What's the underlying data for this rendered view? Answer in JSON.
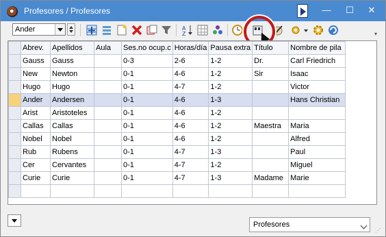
{
  "window": {
    "title": "Profesores / Profesores",
    "minimize": "—",
    "maximize": "☐",
    "close": "✕"
  },
  "toolbar": {
    "selector_value": "Ander",
    "icons": [
      "add-icon",
      "list-icon",
      "new-document-icon",
      "delete-icon",
      "duplicate-icon",
      "filter-icon",
      "sort-icon",
      "grid-settings-icon",
      "wizard-icon",
      "clock-icon",
      "teacher-card-icon",
      "pencil-icon",
      "settings-dropdown-icon",
      "gear-icon",
      "refresh-icon"
    ]
  },
  "grid": {
    "columns": [
      "Abrev.",
      "Apellidos",
      "Aula",
      "Ses.no ocup.c",
      "Horas/día",
      "Pausa extra",
      "Título",
      "Nombre de pila"
    ],
    "rows": [
      [
        "Gauss",
        "Gauss",
        "",
        "0-3",
        "2-6",
        "1-2",
        "Dr.",
        "Carl Friedrich"
      ],
      [
        "New",
        "Newton",
        "",
        "0-1",
        "4-6",
        "1-2",
        "Sir",
        "Isaac"
      ],
      [
        "Hugo",
        "Hugo",
        "",
        "0-1",
        "4-7",
        "1-2",
        "",
        "Victor"
      ],
      [
        "Ander",
        "Andersen",
        "",
        "0-1",
        "4-6",
        "1-3",
        "",
        "Hans Christian"
      ],
      [
        "Arist",
        "Aristoteles",
        "",
        "0-1",
        "4-6",
        "1-2",
        "",
        ""
      ],
      [
        "Callas",
        "Callas",
        "",
        "0-1",
        "4-6",
        "1-2",
        "Maestra",
        "Maria"
      ],
      [
        "Nobel",
        "Nobel",
        "",
        "0-1",
        "4-6",
        "1-2",
        "",
        "Alfred"
      ],
      [
        "Rub",
        "Rubens",
        "",
        "0-1",
        "4-7",
        "1-3",
        "",
        "Paul"
      ],
      [
        "Cer",
        "Cervantes",
        "",
        "0-1",
        "4-7",
        "1-2",
        "",
        "Miguel"
      ],
      [
        "Curie",
        "Curie",
        "",
        "0-1",
        "4-7",
        "1-3",
        "Madame",
        "Marie"
      ]
    ],
    "selected_row": 3
  },
  "bottom": {
    "view_select": "Profesores"
  },
  "colors": {
    "titlebar": "#4a8ad0",
    "highlight_ring": "#c11b1b",
    "selected_row": "#d7def0"
  }
}
